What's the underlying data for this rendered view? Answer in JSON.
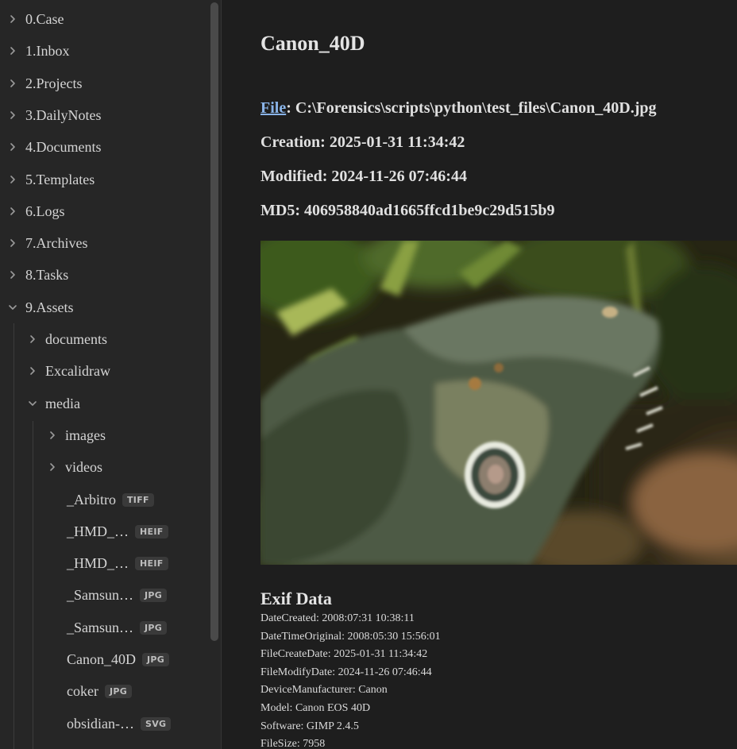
{
  "sidebar": {
    "items": [
      {
        "label": "0.Case",
        "expanded": false
      },
      {
        "label": "1.Inbox",
        "expanded": false
      },
      {
        "label": "2.Projects",
        "expanded": false
      },
      {
        "label": "3.DailyNotes",
        "expanded": false
      },
      {
        "label": "4.Documents",
        "expanded": false
      },
      {
        "label": "5.Templates",
        "expanded": false
      },
      {
        "label": "6.Logs",
        "expanded": false
      },
      {
        "label": "7.Archives",
        "expanded": false
      },
      {
        "label": "8.Tasks",
        "expanded": false
      },
      {
        "label": "9.Assets",
        "expanded": true
      }
    ],
    "assets_children": [
      {
        "label": "documents",
        "expanded": false
      },
      {
        "label": "Excalidraw",
        "expanded": false
      },
      {
        "label": "media",
        "expanded": true
      }
    ],
    "media_folders": [
      {
        "label": "images"
      },
      {
        "label": "videos"
      }
    ],
    "media_files": [
      {
        "label": "_Arbitro",
        "badge": "TIFF"
      },
      {
        "label": "_HMD_…",
        "badge": "HEIF"
      },
      {
        "label": "_HMD_…",
        "badge": "HEIF"
      },
      {
        "label": "_Samsun…",
        "badge": "JPG"
      },
      {
        "label": "_Samsun…",
        "badge": "JPG"
      },
      {
        "label": "Canon_40D",
        "badge": "JPG"
      },
      {
        "label": "coker",
        "badge": "JPG"
      },
      {
        "label": "obsidian-…",
        "badge": "SVG"
      }
    ]
  },
  "note": {
    "title": "Canon_40D",
    "file_link": "File",
    "file_path": ": C:\\Forensics\\scripts\\python\\test_files\\Canon_40D.jpg",
    "creation": "Creation: 2025-01-31 11:34:42",
    "modified": "Modified: 2024-11-26 07:46:44",
    "md5": "MD5: 406958840ad1665ffcd1be9c29d515b9",
    "exif_heading": "Exif Data",
    "exif": [
      "DateCreated: 2008:07:31 10:38:11",
      "DateTimeOriginal: 2008:05:30 15:56:01",
      "FileCreateDate: 2025-01-31 11:34:42",
      "FileModifyDate: 2024-11-26 07:46:44",
      "DeviceManufacturer: Canon",
      "Model: Canon EOS 40D",
      "Software: GIMP 2.4.5",
      "FileSize: 7958"
    ]
  },
  "colors": {
    "background": "#1e1e1e",
    "sidebar": "#262626",
    "link": "#8ab4e8",
    "badge": "#3a3a3a"
  }
}
